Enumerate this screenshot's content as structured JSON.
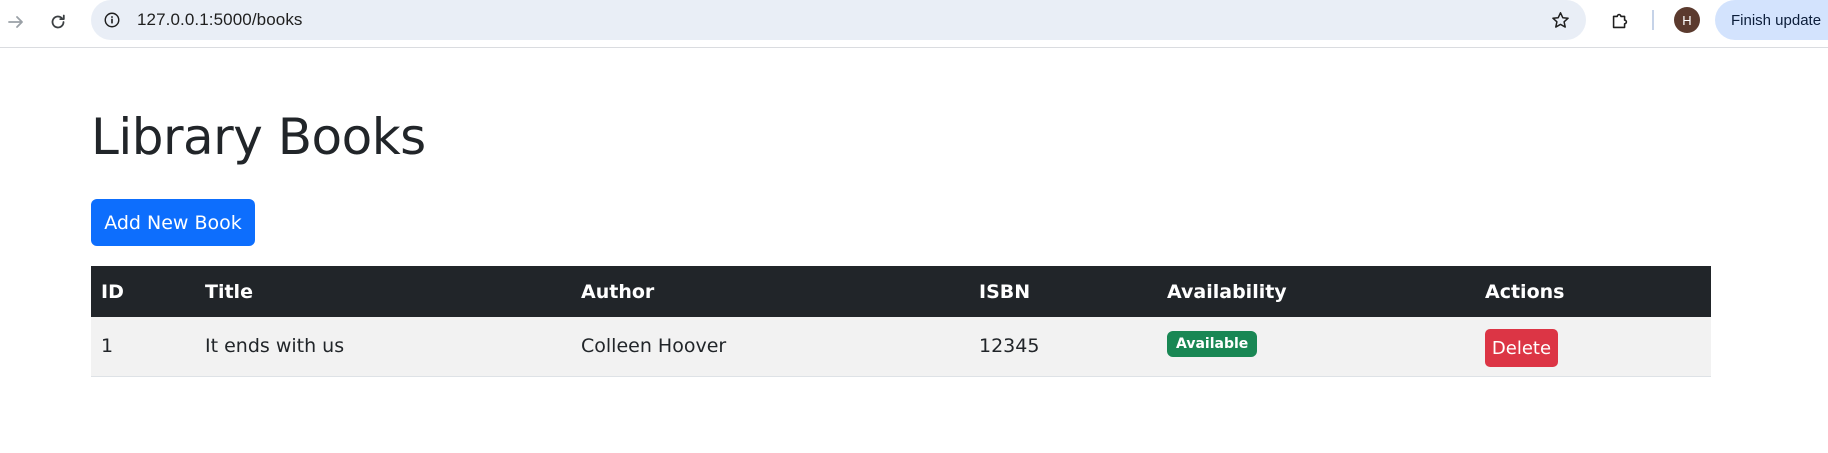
{
  "browser": {
    "url": "127.0.0.1:5000/books",
    "avatar_initial": "H",
    "update_label": "Finish update"
  },
  "page": {
    "title": "Library Books",
    "add_button_label": "Add New Book"
  },
  "table": {
    "headers": [
      "ID",
      "Title",
      "Author",
      "ISBN",
      "Availability",
      "Actions"
    ],
    "rows": [
      {
        "id": "1",
        "title": "It ends with us",
        "author": "Colleen Hoover",
        "isbn": "12345",
        "availability": "Available",
        "action_label": "Delete"
      }
    ]
  },
  "colors": {
    "primary": "#0d6efd",
    "danger": "#dc3545",
    "success": "#198754",
    "table_header": "#212529"
  }
}
